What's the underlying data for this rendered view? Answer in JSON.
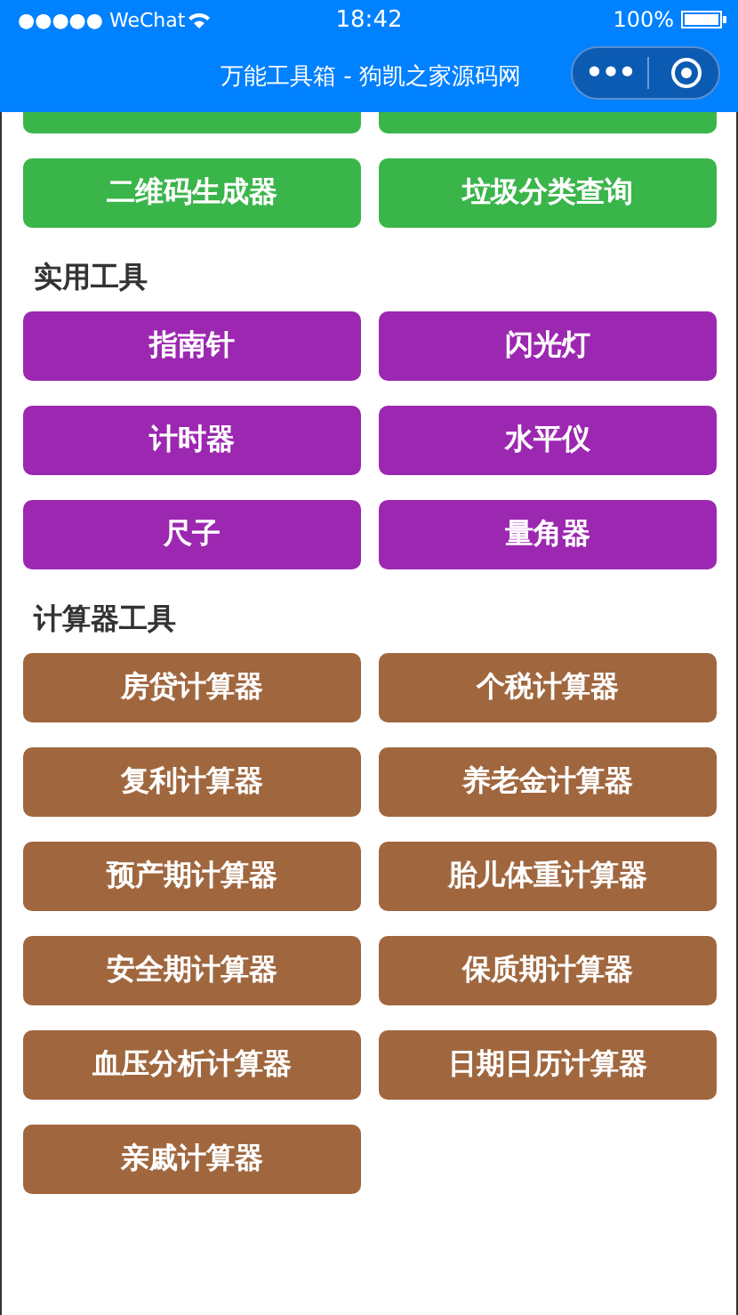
{
  "status_bar": {
    "carrier": "●●●●● WeChat",
    "time": "18:42",
    "battery": "100%"
  },
  "nav_bar": {
    "title": "万能工具箱 - 狗凯之家源码网",
    "capsule_dots": "•••"
  },
  "clipped_buttons": [
    {
      "color": "#3ab54a"
    },
    {
      "color": "#3ab54a"
    }
  ],
  "sections": [
    {
      "color": "#3ab54a",
      "buttons": [
        {
          "label": "二维码生成器"
        },
        {
          "label": "垃圾分类查询"
        }
      ]
    },
    {
      "title": "实用工具",
      "color": "#9c27b0",
      "buttons": [
        {
          "label": "指南针"
        },
        {
          "label": "闪光灯"
        },
        {
          "label": "计时器"
        },
        {
          "label": "水平仪"
        },
        {
          "label": "尺子"
        },
        {
          "label": "量角器"
        }
      ]
    },
    {
      "title": "计算器工具",
      "color": "#a0673f",
      "buttons": [
        {
          "label": "房贷计算器"
        },
        {
          "label": "个税计算器"
        },
        {
          "label": "复利计算器"
        },
        {
          "label": "养老金计算器"
        },
        {
          "label": "预产期计算器"
        },
        {
          "label": "胎儿体重计算器"
        },
        {
          "label": "安全期计算器"
        },
        {
          "label": "保质期计算器"
        },
        {
          "label": "血压分析计算器"
        },
        {
          "label": "日期日历计算器"
        },
        {
          "label": "亲戚计算器"
        }
      ]
    }
  ]
}
